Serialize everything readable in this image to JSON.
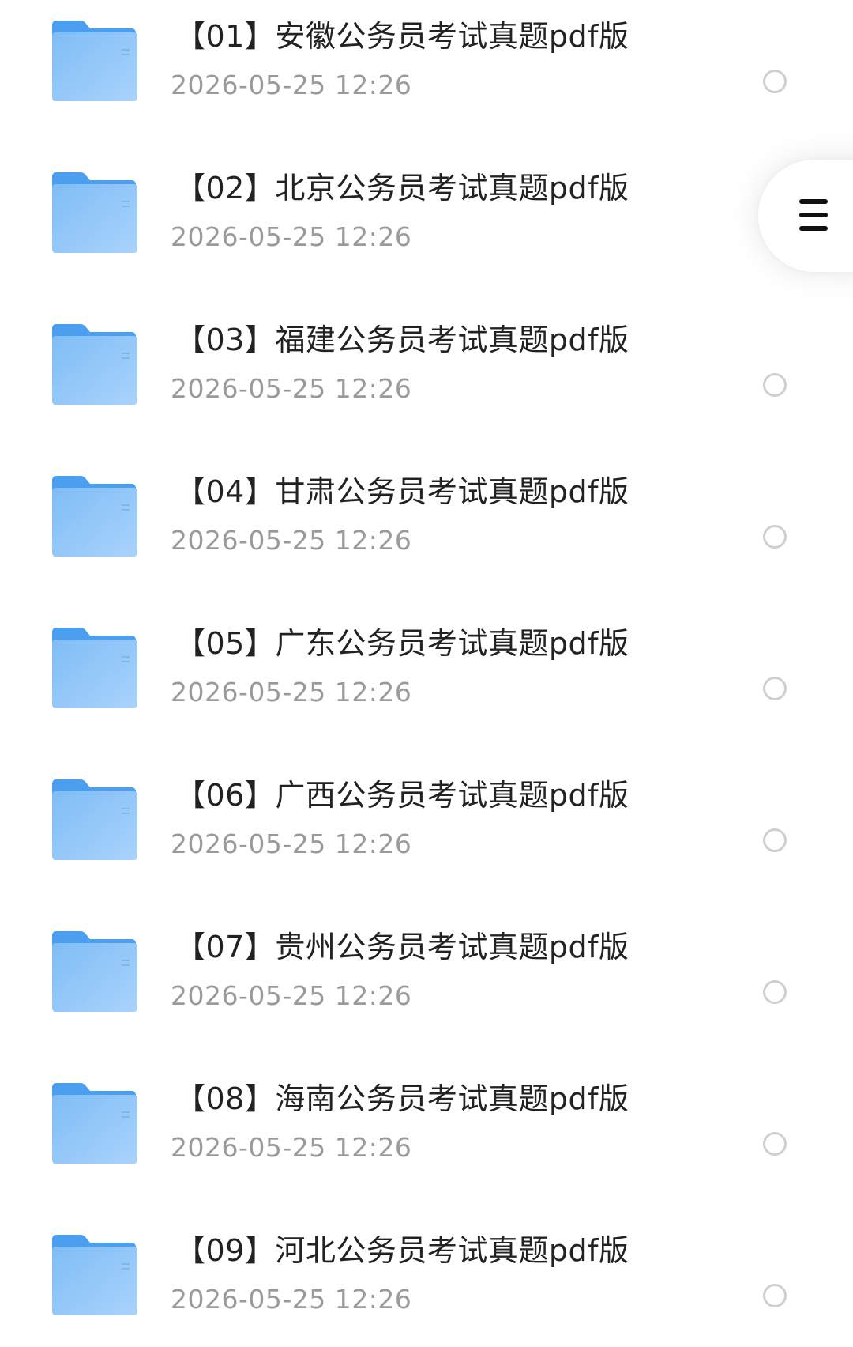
{
  "files": [
    {
      "name": "【01】安徽公务员考试真题pdf版",
      "date": "2026-05-25 12:26",
      "selectable": true
    },
    {
      "name": "【02】北京公务员考试真题pdf版",
      "date": "2026-05-25 12:26",
      "selectable": false
    },
    {
      "name": "【03】福建公务员考试真题pdf版",
      "date": "2026-05-25 12:26",
      "selectable": true
    },
    {
      "name": "【04】甘肃公务员考试真题pdf版",
      "date": "2026-05-25 12:26",
      "selectable": true
    },
    {
      "name": "【05】广东公务员考试真题pdf版",
      "date": "2026-05-25 12:26",
      "selectable": true
    },
    {
      "name": "【06】广西公务员考试真题pdf版",
      "date": "2026-05-25 12:26",
      "selectable": true
    },
    {
      "name": "【07】贵州公务员考试真题pdf版",
      "date": "2026-05-25 12:26",
      "selectable": true
    },
    {
      "name": "【08】海南公务员考试真题pdf版",
      "date": "2026-05-25 12:26",
      "selectable": true
    },
    {
      "name": "【09】河北公务员考试真题pdf版",
      "date": "2026-05-25 12:26",
      "selectable": true
    }
  ],
  "icons": {
    "folder": "folder-icon",
    "radio": "radio-unchecked-icon",
    "menu": "menu-icon"
  },
  "colors": {
    "folder_back": "#4a9ff0",
    "folder_front_top": "#7fbdf6",
    "folder_front_bottom": "#a9d3fb",
    "name_text": "#222222",
    "date_text": "#9a9a9a",
    "radio_border": "#cfcfcf"
  }
}
